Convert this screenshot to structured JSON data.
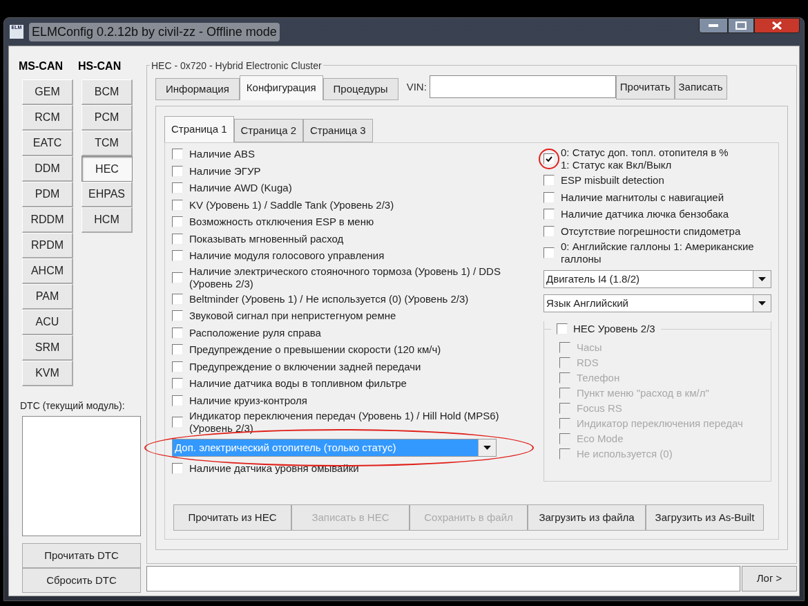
{
  "window": {
    "title": "ELMConfig 0.2.12b by civil-zz - Offline mode",
    "icon_label": "ELM"
  },
  "bus_headers": [
    "MS-CAN",
    "HS-CAN"
  ],
  "ms_can_modules": [
    {
      "label": "GEM",
      "selected": false
    },
    {
      "label": "RCM",
      "selected": false
    },
    {
      "label": "EATC",
      "selected": false
    },
    {
      "label": "DDM",
      "selected": false
    },
    {
      "label": "PDM",
      "selected": false
    },
    {
      "label": "RDDM",
      "selected": false
    },
    {
      "label": "RPDM",
      "selected": false
    },
    {
      "label": "AHCM",
      "selected": false
    },
    {
      "label": "PAM",
      "selected": false
    },
    {
      "label": "ACU",
      "selected": false
    },
    {
      "label": "SRM",
      "selected": false
    },
    {
      "label": "KVM",
      "selected": false
    }
  ],
  "hs_can_modules": [
    {
      "label": "BCM",
      "selected": false
    },
    {
      "label": "PCM",
      "selected": false
    },
    {
      "label": "TCM",
      "selected": false
    },
    {
      "label": "HEC",
      "selected": true
    },
    {
      "label": "EHPAS",
      "selected": false
    },
    {
      "label": "HCM",
      "selected": false
    }
  ],
  "dtc": {
    "label": "DTC (текущий модуль):",
    "buttons": [
      "Прочитать DTC",
      "Сбросить DTC"
    ]
  },
  "module_group": {
    "title": "HEC - 0x720 - Hybrid Electronic Cluster"
  },
  "main_tabs": [
    {
      "label": "Информация",
      "selected": false
    },
    {
      "label": "Конфигурация",
      "selected": true
    },
    {
      "label": "Процедуры",
      "selected": false
    }
  ],
  "vin": {
    "label": "VIN:",
    "buttons": [
      "Прочитать",
      "Записать"
    ]
  },
  "page_tabs": [
    {
      "label": "Страница 1",
      "selected": true
    },
    {
      "label": "Страница 2",
      "selected": false
    },
    {
      "label": "Страница 3",
      "selected": false
    }
  ],
  "options_left": [
    {
      "kind": "checkbox",
      "label": "Наличие ABS",
      "checked": false
    },
    {
      "kind": "checkbox",
      "label": "Наличие ЭГУР",
      "checked": false
    },
    {
      "kind": "checkbox",
      "label": "Наличие AWD (Kuga)",
      "checked": false
    },
    {
      "kind": "checkbox",
      "label": "KV (Уровень 1) / Saddle Tank (Уровень 2/3)",
      "checked": false
    },
    {
      "kind": "checkbox",
      "label": "Возможность отключения ESP в меню",
      "checked": false
    },
    {
      "kind": "checkbox",
      "label": "Показывать мгновенный расход",
      "checked": false
    },
    {
      "kind": "checkbox",
      "label": "Наличие модуля голосового управления",
      "checked": false
    },
    {
      "kind": "checkbox",
      "label": "Наличие электрического стояночного тормоза (Уровень 1) / DDS (Уровень 2/3)",
      "checked": false
    },
    {
      "kind": "checkbox",
      "label": "Beltminder (Уровень 1) / Не используется (0) (Уровень 2/3)",
      "checked": false
    },
    {
      "kind": "checkbox",
      "label": "Звуковой сигнал при непристегнуом ремне",
      "checked": false
    },
    {
      "kind": "checkbox",
      "label": "Расположение руля справа",
      "checked": false
    },
    {
      "kind": "checkbox",
      "label": "Предупреждение о превышении скорости (120 км/ч)",
      "checked": false
    },
    {
      "kind": "checkbox",
      "label": "Предупреждение о включении задней передачи",
      "checked": false
    },
    {
      "kind": "checkbox",
      "label": "Наличие датчика воды в топливном фильтре",
      "checked": false
    },
    {
      "kind": "checkbox",
      "label": "Наличие круиз-контроля",
      "checked": false
    },
    {
      "kind": "checkbox",
      "label": "Индикатор переключения передач (Уровень 1) / Hill Hold (MPS6) (Уровень 2/3)",
      "checked": false
    },
    {
      "kind": "dropdown",
      "value": "Доп. электрический отопитель (только статус)",
      "highlighted": true,
      "circled": true
    },
    {
      "kind": "checkbox",
      "label": "Наличие датчика уровня омывайки",
      "checked": false
    }
  ],
  "options_right": [
    {
      "kind": "checkbox",
      "label": "0: Статус доп. топл. отопителя в %\n1: Статус как Вкл/Выкл",
      "checked": true,
      "circled": true
    },
    {
      "kind": "checkbox",
      "label": "ESP misbuilt detection",
      "checked": false
    },
    {
      "kind": "checkbox",
      "label": "Наличие магнитолы с навигацией",
      "checked": false
    },
    {
      "kind": "checkbox",
      "label": "Наличие датчика лючка бензобака",
      "checked": false
    },
    {
      "kind": "checkbox",
      "label": "Отсутствие погрешности спидометра",
      "checked": false
    },
    {
      "kind": "checkbox",
      "label": "0: Английские галлоны   1: Американские галлоны",
      "checked": false
    },
    {
      "kind": "dropdown",
      "value": "Двигатель I4 (1.8/2)",
      "highlighted": false
    },
    {
      "kind": "dropdown",
      "value": "Язык Английский",
      "highlighted": false
    }
  ],
  "hec_level_group": {
    "label": "HEC Уровень 2/3",
    "checked": false,
    "items": [
      {
        "label": "Часы",
        "checked": false,
        "disabled": true
      },
      {
        "label": "RDS",
        "checked": false,
        "disabled": true
      },
      {
        "label": "Телефон",
        "checked": false,
        "disabled": true
      },
      {
        "label": "Пункт меню \"расход в км/л\"",
        "checked": false,
        "disabled": true
      },
      {
        "label": "Focus RS",
        "checked": false,
        "disabled": true
      },
      {
        "label": "Индикатор переключения передач",
        "checked": false,
        "disabled": true
      },
      {
        "label": "Eco Mode",
        "checked": false,
        "disabled": true
      },
      {
        "label": "Не используется (0)",
        "checked": false,
        "disabled": true
      }
    ]
  },
  "action_buttons": [
    {
      "label": "Прочитать из HEC",
      "disabled": false
    },
    {
      "label": "Записать в HEC",
      "disabled": true
    },
    {
      "label": "Сохранить в файл",
      "disabled": true
    },
    {
      "label": "Загрузить из файла",
      "disabled": false
    },
    {
      "label": "Загрузить из As-Built",
      "disabled": false
    }
  ],
  "log": {
    "button": "Лог >"
  }
}
